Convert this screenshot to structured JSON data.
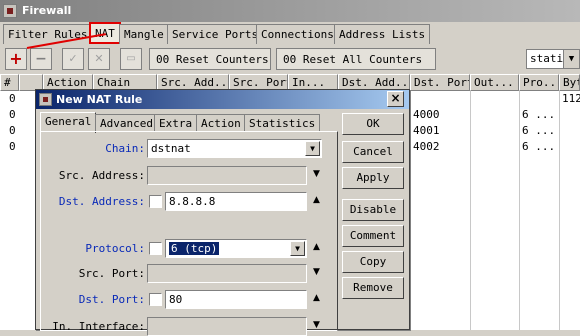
{
  "window": {
    "title": "Firewall"
  },
  "tabs": [
    "Filter Rules",
    "NAT",
    "Mangle",
    "Service Ports",
    "Connections",
    "Address Lists"
  ],
  "toolbar": {
    "reset_counters": "00 Reset Counters",
    "reset_all_counters": "00 Reset All Counters",
    "filter_value": "static"
  },
  "table": {
    "columns": [
      "#",
      "",
      "Action",
      "Chain",
      "Src. Add...",
      "Src. Port",
      "In...",
      "Dst. Add...",
      "Dst. Port",
      "Out...",
      "Pro...",
      "Byt"
    ],
    "rows": [
      {
        "marker": "0",
        "dst_port": "",
        "proto": "",
        "bytes": "112"
      },
      {
        "marker": "0",
        "dst_port": "4000",
        "proto": "6 ...",
        "bytes": ""
      },
      {
        "marker": "0",
        "dst_port": "4001",
        "proto": "6 ...",
        "bytes": ""
      },
      {
        "marker": "0",
        "dst_port": "4002",
        "proto": "6 ...",
        "bytes": ""
      }
    ]
  },
  "dialog": {
    "title": "New NAT Rule",
    "close": "×",
    "tabs": [
      "General",
      "Advanced",
      "Extra",
      "Action",
      "Statistics"
    ],
    "fields": {
      "chain": {
        "label": "Chain:",
        "value": "dstnat"
      },
      "src_address": {
        "label": "Src. Address:",
        "value": ""
      },
      "dst_address": {
        "label": "Dst. Address:",
        "value": "8.8.8.8"
      },
      "protocol": {
        "label": "Protocol:",
        "value": "6 (tcp)"
      },
      "src_port": {
        "label": "Src. Port:",
        "value": ""
      },
      "dst_port": {
        "label": "Dst. Port:",
        "value": "80"
      },
      "in_interface": {
        "label": "In. Interface:",
        "value": ""
      }
    },
    "buttons": {
      "ok": "OK",
      "cancel": "Cancel",
      "apply": "Apply",
      "disable": "Disable",
      "comment": "Comment",
      "copy": "Copy",
      "remove": "Remove"
    }
  },
  "colors": {
    "highlight": "#e00000",
    "dialog_title": "#0a246a",
    "field_label_blue": "#0a2ab8"
  }
}
